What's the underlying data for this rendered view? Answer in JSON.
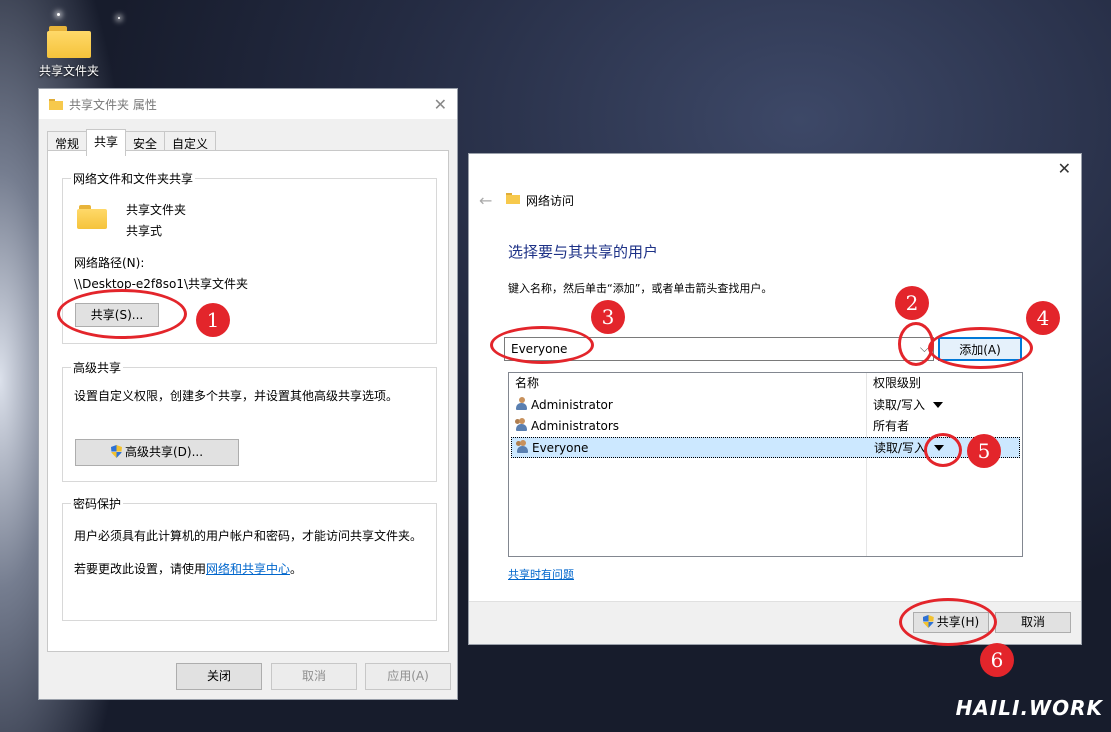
{
  "desktop": {
    "icon_label": "共享文件夹",
    "watermark": "HAILI.WORK"
  },
  "props": {
    "title": "共享文件夹 属性",
    "tabs": [
      "常规",
      "共享",
      "安全",
      "自定义"
    ],
    "net_group_title": "网络文件和文件夹共享",
    "folder_name": "共享文件夹",
    "folder_state": "共享式",
    "path_label": "网络路径(N):",
    "path_value": "\\\\Desktop-e2f8so1\\共享文件夹",
    "share_button": "共享(S)...",
    "adv_group_title": "高级共享",
    "adv_desc": "设置自定义权限，创建多个共享，并设置其他高级共享选项。",
    "adv_button": "高级共享(D)...",
    "pwd_group_title": "密码保护",
    "pwd_desc": "用户必须具有此计算机的用户帐户和密码，才能访问共享文件夹。",
    "pwd_change_prefix": "若要更改此设置，请使用",
    "pwd_change_link": "网络和共享中心",
    "pwd_change_suffix": "。",
    "close_button": "关闭",
    "cancel_button": "取消",
    "apply_button": "应用(A)"
  },
  "netaccess": {
    "title": "网络访问",
    "heading": "选择要与其共享的用户",
    "instruction": "键入名称，然后单击“添加”，或者单击箭头查找用户。",
    "input_value": "Everyone",
    "add_button": "添加(A)",
    "col_name": "名称",
    "col_perm": "权限级别",
    "users": [
      {
        "name": "Administrator",
        "perm": "读取/写入"
      },
      {
        "name": "Administrators",
        "perm": "所有者"
      },
      {
        "name": "Everyone",
        "perm": "读取/写入"
      }
    ],
    "trouble_link": "共享时有问题",
    "share_button": "共享(H)",
    "cancel_button": "取消"
  },
  "annotations": [
    "1",
    "2",
    "3",
    "4",
    "5",
    "6"
  ],
  "colors": {
    "annotation": "#e3252b",
    "link": "#0066cc",
    "selection": "#cce8ff"
  }
}
